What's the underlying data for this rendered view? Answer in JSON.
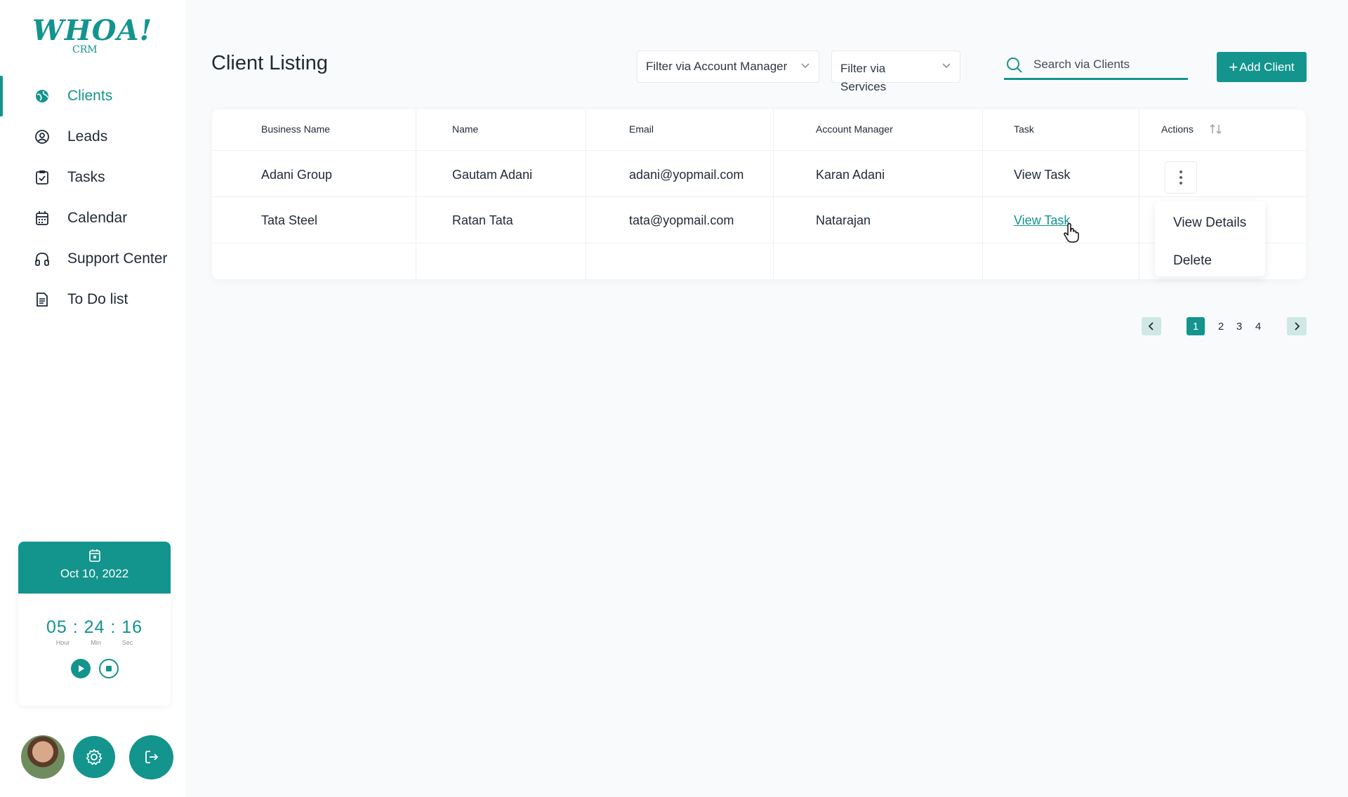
{
  "brand": {
    "logo_text": "WHOA!",
    "logo_sub": "CRM"
  },
  "colors": {
    "accent": "#13948d",
    "text": "#1f2a37",
    "background": "#f9fafc",
    "pager_arrow_bg": "#cfe8e6"
  },
  "sidebar": {
    "items": [
      {
        "label": "Clients",
        "icon": "globe-icon",
        "active": true
      },
      {
        "label": "Leads",
        "icon": "user-circle-icon",
        "active": false
      },
      {
        "label": "Tasks",
        "icon": "clipboard-check-icon",
        "active": false
      },
      {
        "label": "Calendar",
        "icon": "calendar-icon",
        "active": false
      },
      {
        "label": "Support Center",
        "icon": "headphones-icon",
        "active": false
      },
      {
        "label": "To Do list",
        "icon": "document-icon",
        "active": false
      }
    ]
  },
  "timer": {
    "date": "Oct 10, 2022",
    "time": "05 : 24 : 16",
    "units": {
      "hour": "Hour",
      "min": "Min",
      "sec": "Sec"
    }
  },
  "header": {
    "title": "Client Listing",
    "filter_account_manager": "Filter via Account Manager",
    "filter_services_line1": "Filter via",
    "filter_services_line2": "Services",
    "search_placeholder": "Search via Clients",
    "add_client": "Add Client"
  },
  "table": {
    "columns": [
      "Business Name",
      "Name",
      "Email",
      "Account Manager",
      "Task",
      "Actions"
    ],
    "rows": [
      {
        "business": "Adani Group",
        "name": "Gautam Adani",
        "email": "adani@yopmail.com",
        "manager": "Karan Adani",
        "task": "View Task"
      },
      {
        "business": "Tata Steel",
        "name": "Ratan Tata",
        "email": "tata@yopmail.com",
        "manager": "Natarajan",
        "task": "View Task"
      }
    ]
  },
  "actions_menu": {
    "view_details": "View Details",
    "delete": "Delete"
  },
  "pagination": {
    "pages": [
      "1",
      "2",
      "3",
      "4"
    ],
    "current": "1"
  }
}
